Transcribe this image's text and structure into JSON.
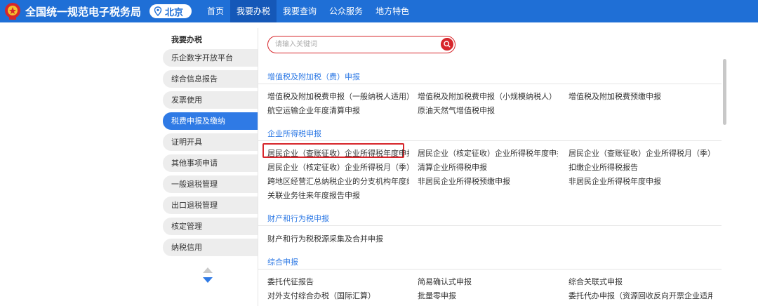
{
  "header": {
    "site_title": "全国统一规范电子税务局",
    "city": "北京",
    "nav": [
      "首页",
      "我要办税",
      "我要查询",
      "公众服务",
      "地方特色"
    ],
    "active_nav_index": 1,
    "brand_color": "#1f6fd6"
  },
  "sidebar": {
    "title": "我要办税",
    "items": [
      "乐企数字开放平台",
      "综合信息报告",
      "发票使用",
      "税费申报及缴纳",
      "证明开具",
      "其他事项申请",
      "一般退税管理",
      "出口退税管理",
      "核定管理",
      "纳税信用"
    ],
    "active_index": 3
  },
  "search": {
    "placeholder": "请输入关键词"
  },
  "sections": [
    {
      "title": "增值税及附加税（费）申报",
      "rows": [
        [
          "增值税及附加税费申报（一般纳税人适用）",
          "增值税及附加税费申报（小规模纳税人）",
          "增值税及附加税费预缴申报"
        ],
        [
          "航空运输企业年度清算申报",
          "原油天然气增值税申报",
          ""
        ]
      ]
    },
    {
      "title": "企业所得税申报",
      "rows": [
        [
          "居民企业（查账征收）企业所得税年度申报",
          "居民企业（核定征收）企业所得税年度申报",
          "居民企业（查账征收）企业所得税月（季）度..."
        ],
        [
          "居民企业（核定征收）企业所得税月（季）度...",
          "清算企业所得税申报",
          "扣缴企业所得税报告"
        ],
        [
          "跨地区经营汇总纳税企业的分支机构年度纳税...",
          "非居民企业所得税预缴申报",
          "非居民企业所得税年度申报"
        ],
        [
          "关联业务往来年度报告申报",
          "",
          ""
        ]
      ]
    },
    {
      "title": "财产和行为税申报",
      "rows": [
        [
          "财产和行为税税源采集及合并申报",
          "",
          ""
        ]
      ]
    },
    {
      "title": "综合申报",
      "rows": [
        [
          "委托代征报告",
          "简易确认式申报",
          "综合关联式申报"
        ],
        [
          "对外支付综合办税（国际汇算）",
          "批量零申报",
          "委托代办申报（资源回收反向开票企业适用）"
        ]
      ]
    }
  ]
}
